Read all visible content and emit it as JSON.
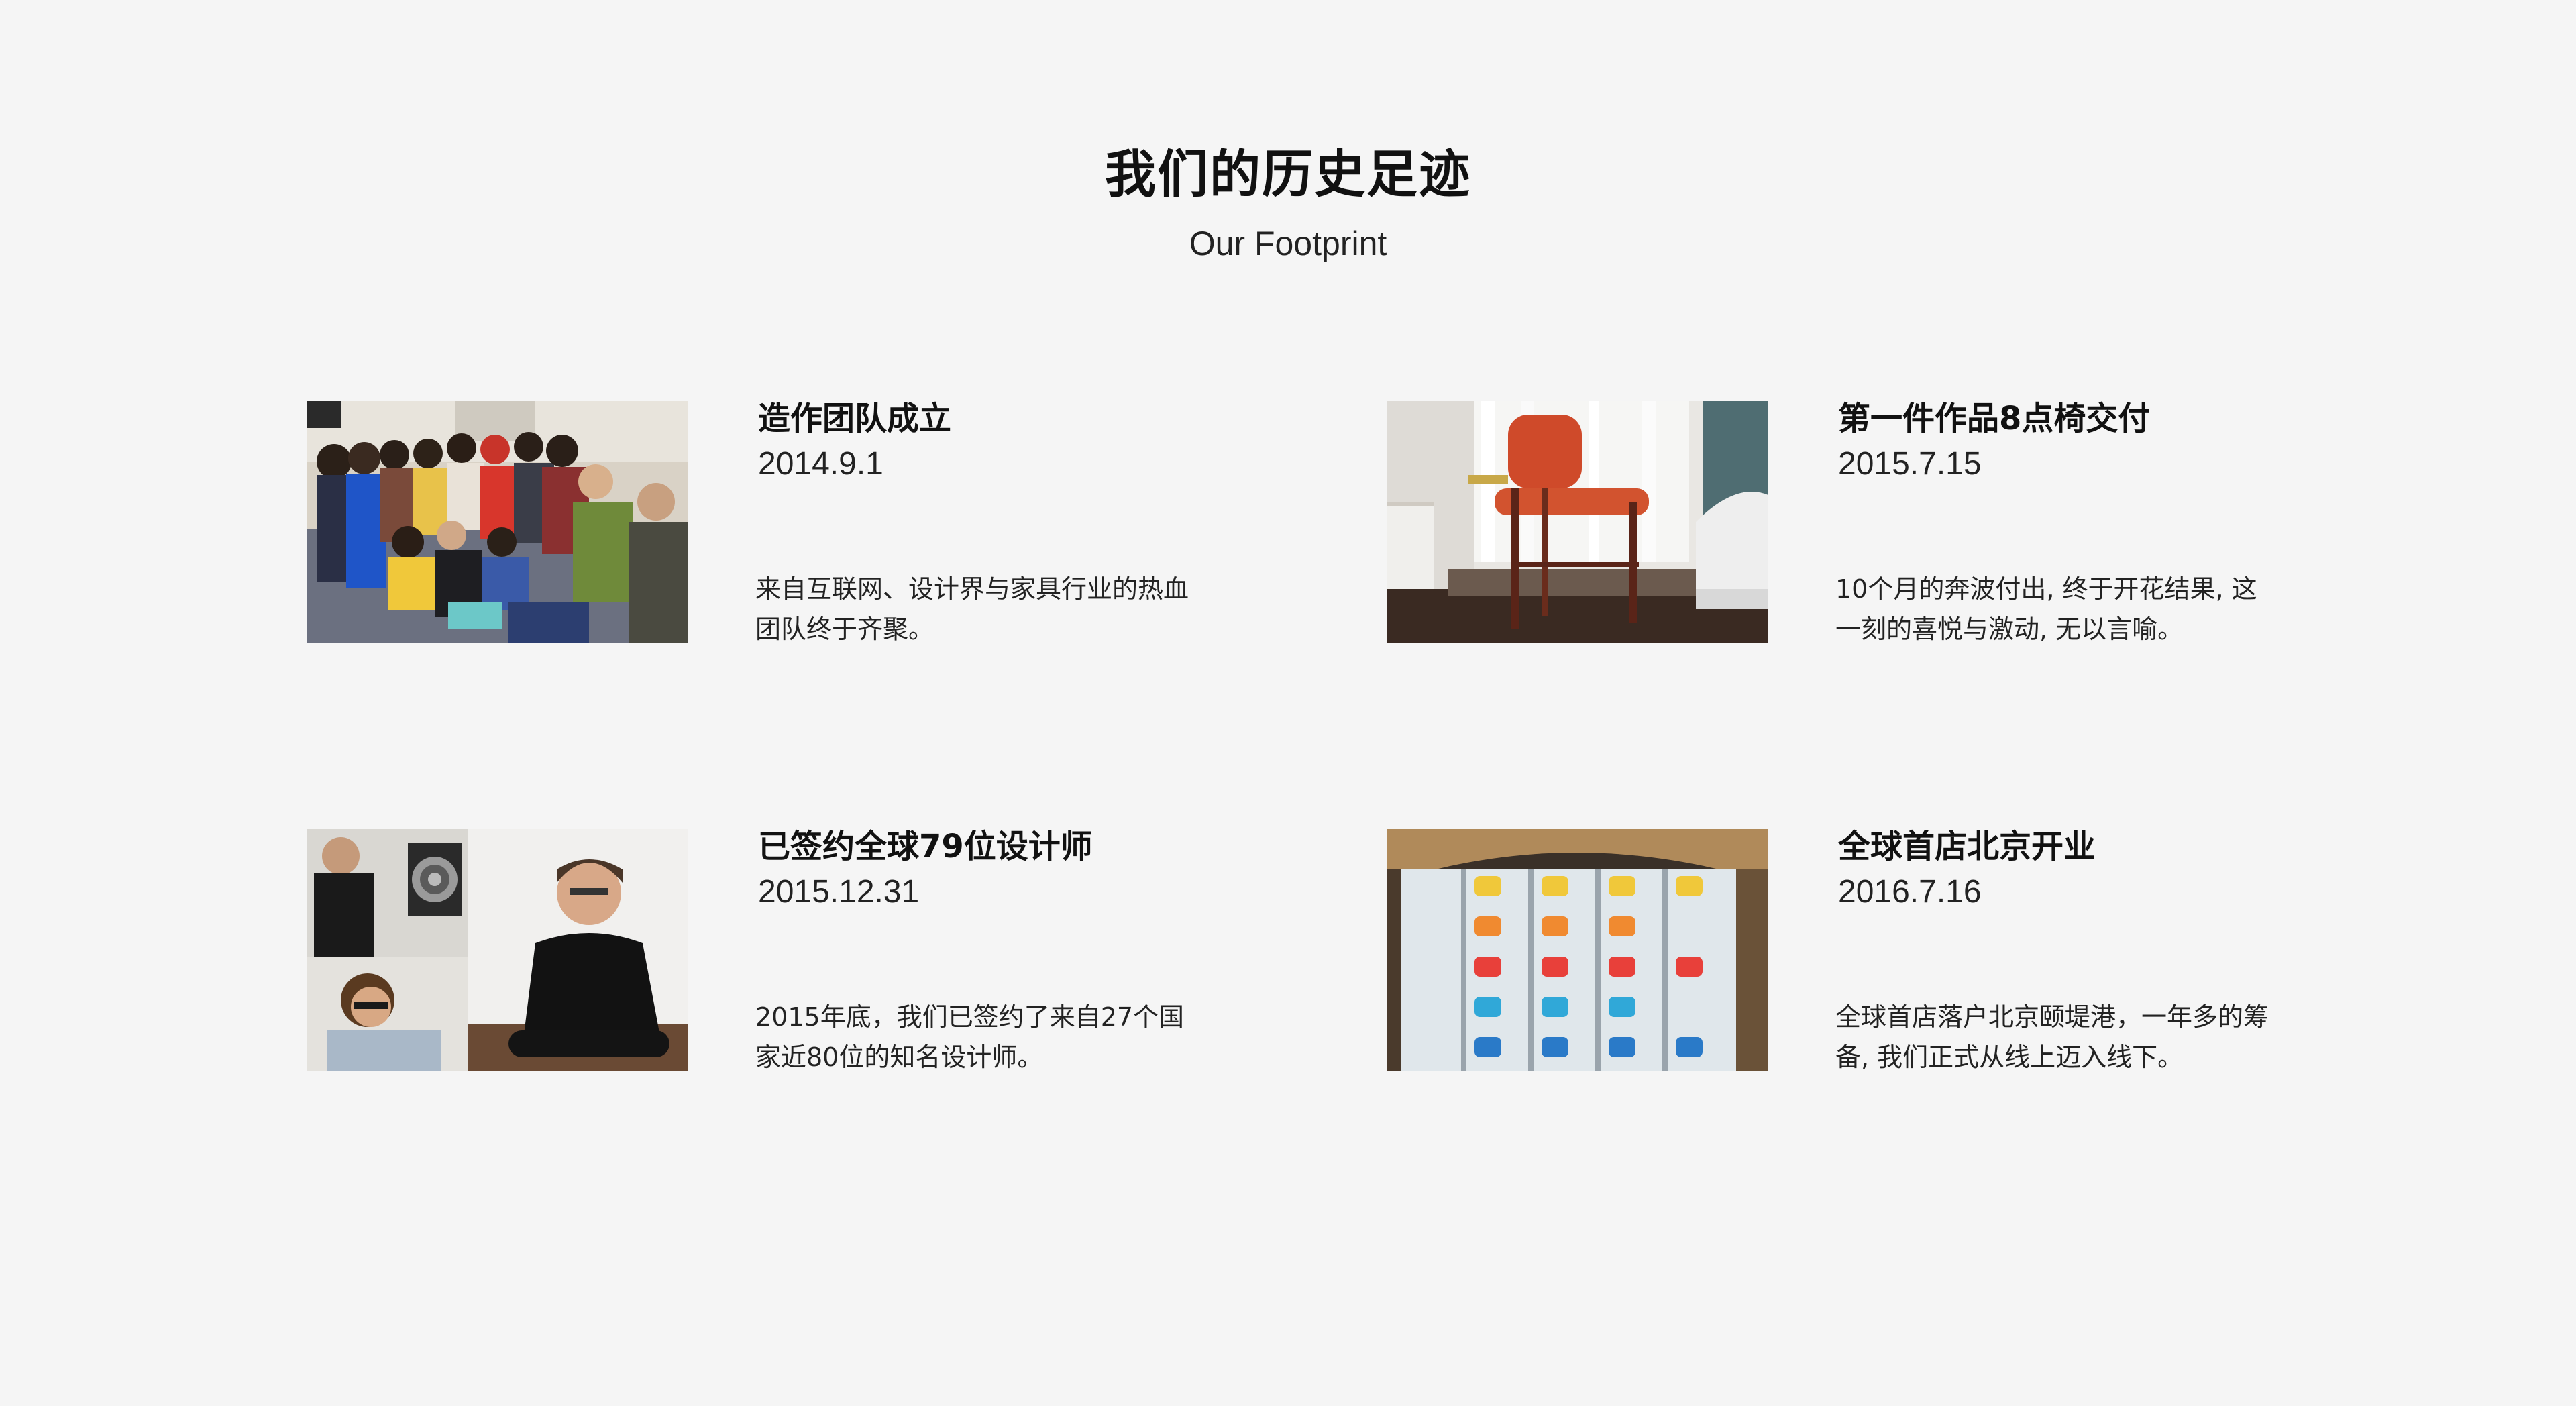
{
  "section": {
    "title": "我们的历史足迹",
    "subtitle": "Our Footprint"
  },
  "milestones": [
    {
      "title": "造作团队成立",
      "date": "2014.9.1",
      "description": "来自互联网、设计界与家具行业的热血团队终于齐聚。",
      "image": "team-group-photo"
    },
    {
      "title": "第一件作品8点椅交付",
      "date": "2015.7.15",
      "description": "10个月的奔波付出, 终于开花结果, 这一刻的喜悦与激动, 无以言喻。",
      "image": "red-chair-photo"
    },
    {
      "title": "已签约全球79位设计师",
      "date": "2015.12.31",
      "description": "2015年底，我们已签约了来自27个国家近80位的知名设计师。",
      "image": "designers-collage-photo"
    },
    {
      "title": "全球首店北京开业",
      "date": "2016.7.16",
      "description": "全球首店落户北京颐堤港，一年多的筹备, 我们正式从线上迈入线下。",
      "image": "store-display-photo"
    }
  ]
}
